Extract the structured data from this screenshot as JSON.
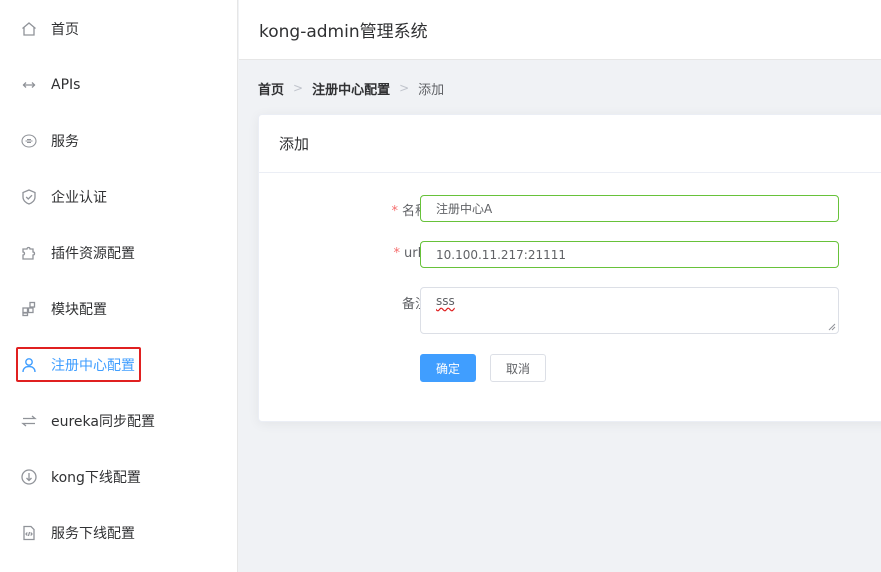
{
  "sidebar": {
    "items": [
      {
        "label": "首页",
        "icon": "home-icon"
      },
      {
        "label": "APIs",
        "icon": "api-icon"
      },
      {
        "label": "服务",
        "icon": "service-icon"
      },
      {
        "label": "企业认证",
        "icon": "shield-icon"
      },
      {
        "label": "插件资源配置",
        "icon": "puzzle-icon"
      },
      {
        "label": "模块配置",
        "icon": "grid-icon"
      },
      {
        "label": "注册中心配置",
        "icon": "user-icon",
        "active": true
      },
      {
        "label": "eureka同步配置",
        "icon": "sync-icon"
      },
      {
        "label": "kong下线配置",
        "icon": "download-circle-icon"
      },
      {
        "label": "服务下线配置",
        "icon": "code-file-icon"
      }
    ]
  },
  "header": {
    "title": "kong-admin管理系统"
  },
  "breadcrumb": {
    "items": [
      "首页",
      "注册中心配置",
      "添加"
    ]
  },
  "card": {
    "title": "添加"
  },
  "form": {
    "name_label": "名称",
    "name_value": "注册中心A",
    "urls_label": "urls",
    "urls_value": "10.100.11.217:21111",
    "remark_label": "备注",
    "remark_value": "sss",
    "required_mark": "*",
    "confirm_label": "确定",
    "cancel_label": "取消"
  },
  "colors": {
    "accent": "#409eff",
    "valid_border": "#67c23a",
    "required": "#f56c6c",
    "highlight_frame": "#e02020"
  }
}
